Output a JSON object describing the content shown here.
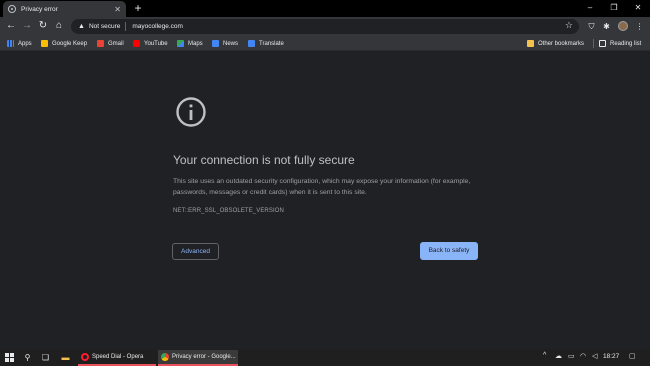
{
  "tab": {
    "title": "Privacy error",
    "close_glyph": "✕",
    "favicon": "globe-icon"
  },
  "new_tab_glyph": "+",
  "window_controls": {
    "minimize": "–",
    "restore": "❐",
    "close": "✕"
  },
  "toolbar": {
    "back_glyph": "←",
    "forward_glyph": "→",
    "reload_glyph": "↻",
    "home_glyph": "⌂",
    "security_warning_glyph": "▲",
    "security_label": "Not secure",
    "url": "mayocollege.com",
    "star_glyph": "☆",
    "pocket_glyph": "⛉",
    "extensions_glyph": "✱",
    "menu_glyph": "⋮"
  },
  "bookmarks": {
    "items": [
      {
        "label": "Apps",
        "icon": "apps-icon"
      },
      {
        "label": "Google Keep",
        "icon": "google-keep-icon"
      },
      {
        "label": "Gmail",
        "icon": "gmail-icon"
      },
      {
        "label": "YouTube",
        "icon": "youtube-icon"
      },
      {
        "label": "Maps",
        "icon": "maps-icon"
      },
      {
        "label": "News",
        "icon": "news-icon"
      },
      {
        "label": "Translate",
        "icon": "translate-icon"
      }
    ],
    "other_bookmarks": "Other bookmarks",
    "reading_list": "Reading list"
  },
  "page": {
    "heading": "Your connection is not fully secure",
    "description": "This site uses an outdated security configuration, which may expose your information (for example, passwords, messages or credit cards) when it is sent to this site.",
    "error_code": "NET::ERR_SSL_OBSOLETE_VERSION",
    "advanced_label": "Advanced",
    "back_to_safety_label": "Back to safety"
  },
  "taskbar": {
    "apps": [
      {
        "label": "Speed Dial - Opera"
      },
      {
        "label": "Privacy error - Google..."
      }
    ],
    "tray": {
      "chevron": "^",
      "clock": "18:27"
    }
  },
  "colors": {
    "page_bg": "#202124",
    "toolbar_bg": "#35363a",
    "link_blue": "#8ab4f8",
    "heading": "#bdc1c6",
    "body_text": "#9aa0a6"
  }
}
